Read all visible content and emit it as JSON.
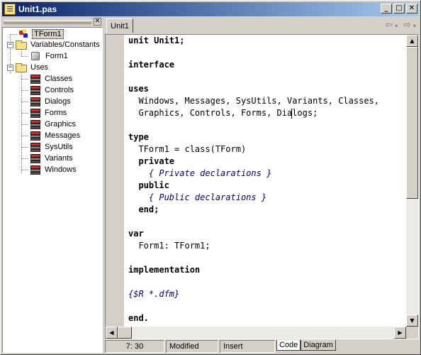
{
  "window": {
    "title": "Unit1.pas",
    "buttons": {
      "minimize": "_",
      "maximize": "□",
      "close": "✕"
    }
  },
  "explorer": {
    "close_label": "✕",
    "nodes": [
      {
        "label": "TForm1",
        "icon": "unit-class-icon",
        "selected": true
      },
      {
        "label": "Variables/Constants",
        "icon": "folder-icon",
        "expander": "−"
      },
      {
        "label": "Form1",
        "icon": "variable-icon"
      },
      {
        "label": "Uses",
        "icon": "folder-icon",
        "expander": "−"
      },
      {
        "label": "Classes",
        "icon": "unit-library-icon"
      },
      {
        "label": "Controls",
        "icon": "unit-library-icon"
      },
      {
        "label": "Dialogs",
        "icon": "unit-library-icon"
      },
      {
        "label": "Forms",
        "icon": "unit-library-icon"
      },
      {
        "label": "Graphics",
        "icon": "unit-library-icon"
      },
      {
        "label": "Messages",
        "icon": "unit-library-icon"
      },
      {
        "label": "SysUtils",
        "icon": "unit-library-icon"
      },
      {
        "label": "Variants",
        "icon": "unit-library-icon"
      },
      {
        "label": "Windows",
        "icon": "unit-library-icon"
      }
    ]
  },
  "editor": {
    "tab_label": "Unit1",
    "nav": {
      "back": "⇦",
      "back_drop": "▾",
      "forward": "⇨",
      "forward_drop": "▾"
    },
    "code_lines": [
      "unit Unit1;",
      "",
      "interface",
      "",
      "uses",
      "  Windows, Messages, SysUtils, Variants, Classes,",
      "  Graphics, Controls, Forms, Dialogs;",
      "",
      "type",
      "  TForm1 = class(TForm)",
      "  private",
      "    { Private declarations }",
      "  public",
      "    { Public declarations }",
      "  end;",
      "",
      "var",
      "  Form1: TForm1;",
      "",
      "implementation",
      "",
      "{$R *.dfm}",
      "",
      "end."
    ],
    "scroll": {
      "up": "▲",
      "down": "▼",
      "left": "◀",
      "right": "▶"
    }
  },
  "statusbar": {
    "position": "7:  30",
    "modified": "Modified",
    "mode": "Insert",
    "tabs": [
      "Code",
      "Diagram"
    ]
  }
}
